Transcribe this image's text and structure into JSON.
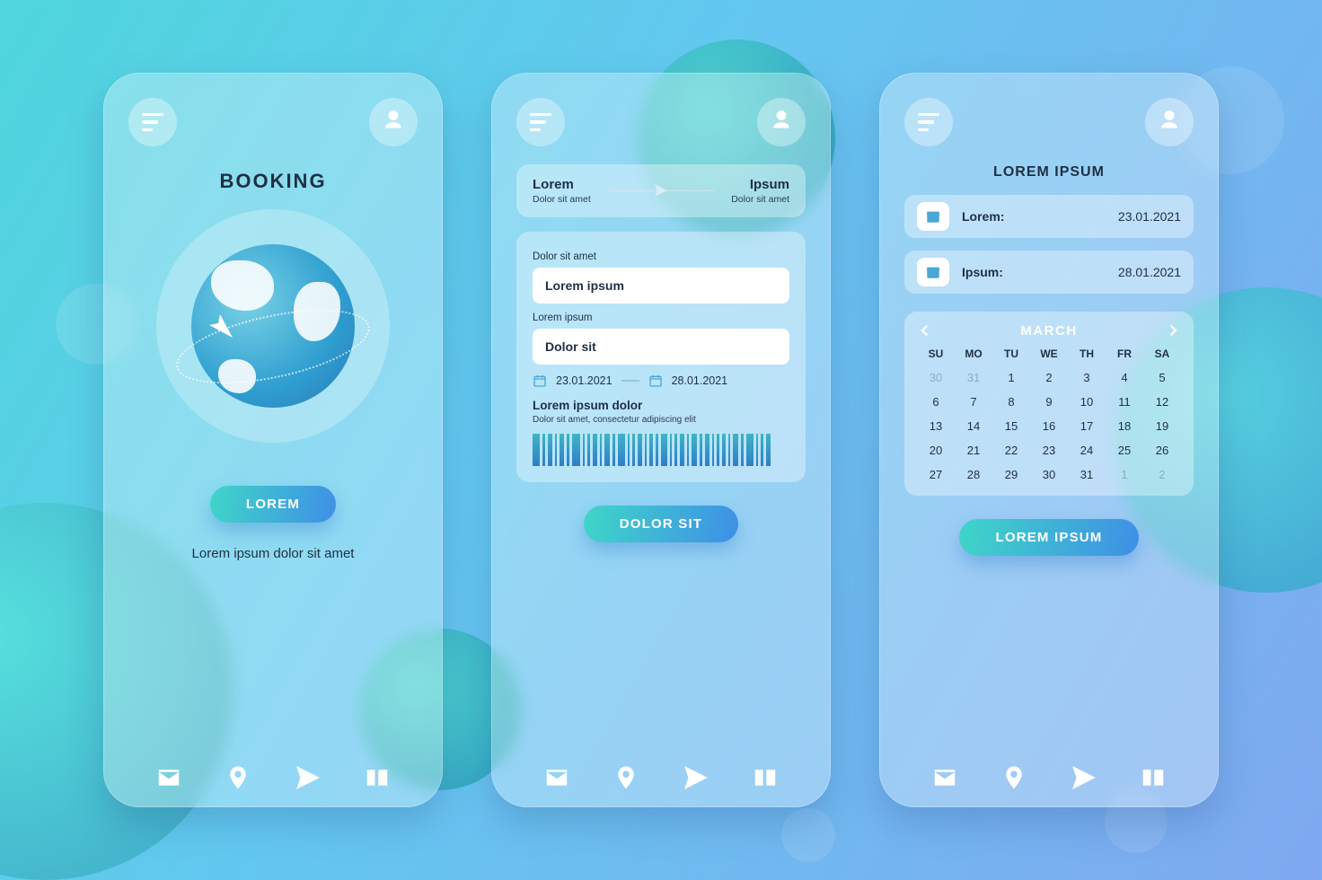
{
  "screens": {
    "booking": {
      "title": "BOOKING",
      "cta": "LOREM",
      "caption": "Lorem ipsum dolor sit amet"
    },
    "ticket": {
      "from_title": "Lorem",
      "from_sub": "Dolor sit amet",
      "to_title": "Ipsum",
      "to_sub": "Dolor sit amet",
      "field1_label": "Dolor sit amet",
      "field1_value": "Lorem ipsum",
      "field2_label": "Lorem ipsum",
      "field2_value": "Dolor sit",
      "date_from": "23.01.2021",
      "date_to": "28.01.2021",
      "summary_title": "Lorem ipsum dolor",
      "summary_sub": "Dolor sit amet, consectetur adipiscing elit",
      "cta": "DOLOR SIT"
    },
    "dates": {
      "title": "LOREM IPSUM",
      "row1_label": "Lorem:",
      "row1_value": "23.01.2021",
      "row2_label": "Ipsum:",
      "row2_value": "28.01.2021",
      "month": "MARCH",
      "dow": [
        "SU",
        "MO",
        "TU",
        "WE",
        "TH",
        "FR",
        "SA"
      ],
      "days": [
        {
          "n": 30,
          "dim": true
        },
        {
          "n": 31,
          "dim": true
        },
        {
          "n": 1
        },
        {
          "n": 2
        },
        {
          "n": 3
        },
        {
          "n": 4
        },
        {
          "n": 5
        },
        {
          "n": 6
        },
        {
          "n": 7
        },
        {
          "n": 8
        },
        {
          "n": 9
        },
        {
          "n": 10
        },
        {
          "n": 11
        },
        {
          "n": 12
        },
        {
          "n": 13
        },
        {
          "n": 14
        },
        {
          "n": 15
        },
        {
          "n": 16
        },
        {
          "n": 17
        },
        {
          "n": 18
        },
        {
          "n": 19
        },
        {
          "n": 20
        },
        {
          "n": 21
        },
        {
          "n": 22
        },
        {
          "n": 23
        },
        {
          "n": 24
        },
        {
          "n": 25
        },
        {
          "n": 26
        },
        {
          "n": 27
        },
        {
          "n": 28
        },
        {
          "n": 29
        },
        {
          "n": 30
        },
        {
          "n": 31
        },
        {
          "n": 1,
          "dim": true
        },
        {
          "n": 2,
          "dim": true
        }
      ],
      "cta": "LOREM IPSUM"
    }
  },
  "barcode_widths": [
    8,
    3,
    5,
    2,
    5,
    3,
    9,
    2,
    3,
    5,
    2,
    6,
    3,
    8,
    2,
    3,
    5,
    2,
    4,
    3,
    7,
    2,
    3,
    5,
    2,
    6,
    3,
    5,
    2,
    3,
    4,
    2,
    6,
    3,
    8,
    2,
    3,
    5
  ]
}
